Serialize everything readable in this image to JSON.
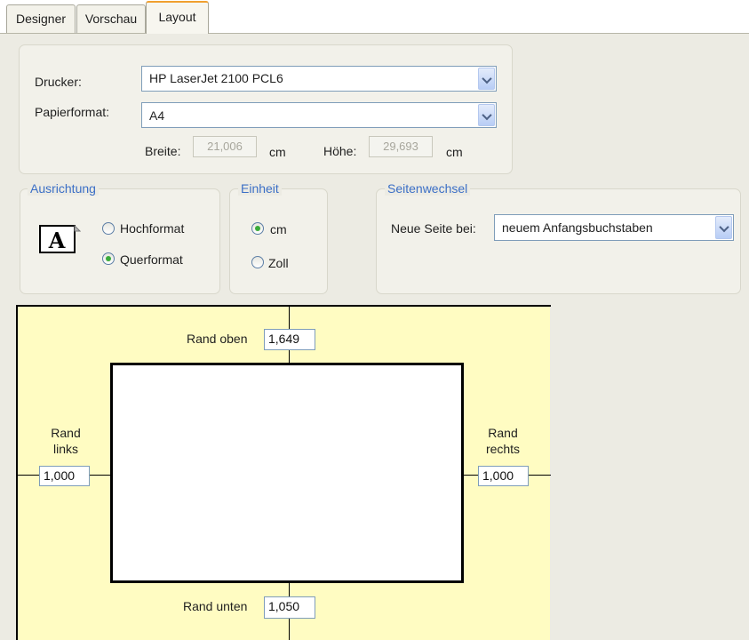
{
  "tabs": [
    {
      "label": "Designer"
    },
    {
      "label": "Vorschau"
    },
    {
      "label": "Layout"
    }
  ],
  "printer_panel": {
    "printer_label": "Drucker:",
    "printer_value": "HP LaserJet 2100 PCL6",
    "paper_label": "Papierformat:",
    "paper_value": "A4",
    "width_label": "Breite:",
    "width_value": "21,006",
    "width_unit": "cm",
    "height_label": "Höhe:",
    "height_value": "29,693",
    "height_unit": "cm"
  },
  "orientation": {
    "title": "Ausrichtung",
    "icon_letter": "A",
    "portrait_label": "Hochformat",
    "landscape_label": "Querformat",
    "selected": "landscape"
  },
  "unit": {
    "title": "Einheit",
    "cm_label": "cm",
    "inch_label": "Zoll",
    "selected": "cm"
  },
  "page_break": {
    "title": "Seitenwechsel",
    "new_page_label": "Neue Seite bei:",
    "new_page_value": "neuem Anfangsbuchstaben"
  },
  "margins": {
    "top_label": "Rand oben",
    "top_value": "1,649",
    "left_label_line1": "Rand",
    "left_label_line2": "links",
    "left_value": "1,000",
    "right_label_line1": "Rand",
    "right_label_line2": "rechts",
    "right_value": "1,000",
    "bottom_label": "Rand unten",
    "bottom_value": "1,050"
  },
  "colors": {
    "group_title": "#3b6fc6",
    "active_tab_accent": "#f0a030",
    "editor_background": "#fffcc2",
    "radio_selected": "#3aab3a"
  }
}
